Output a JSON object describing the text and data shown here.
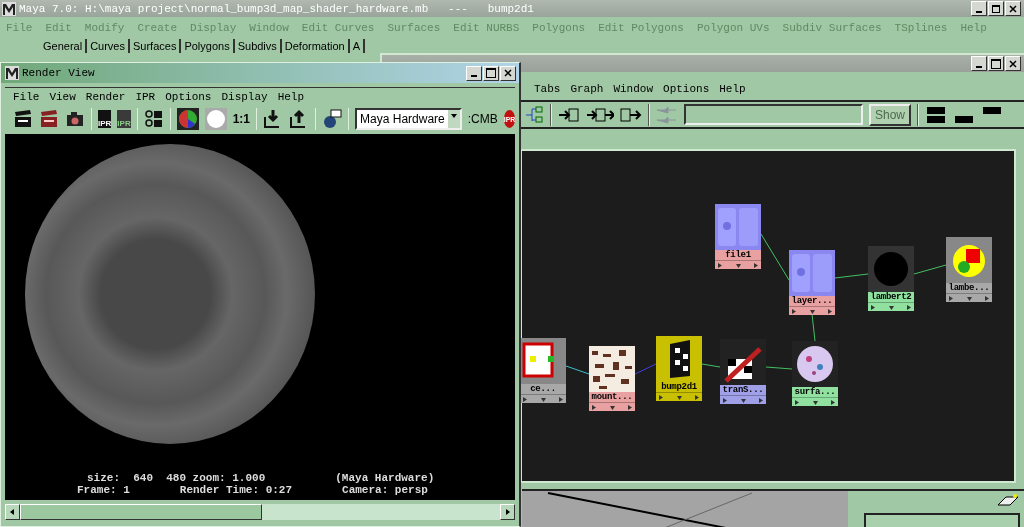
{
  "main_window": {
    "title": "Maya 7.0: H:\\maya project\\normal_bump3d_map_shader_hardware.mb   ---   bump2d1",
    "menu": [
      "File",
      "Edit",
      "Modify",
      "Create",
      "Display",
      "Window",
      "Edit Curves",
      "Surfaces",
      "Edit NURBS",
      "Polygons",
      "Edit Polygons",
      "Polygon UVs",
      "Subdiv Surfaces",
      "TSplines",
      "Help"
    ],
    "shelf_tabs": [
      "General",
      "Curves",
      "Surfaces",
      "Polygons",
      "Subdivs",
      "Deformation",
      "A"
    ]
  },
  "render_view": {
    "title": "Render View",
    "menu": [
      "File",
      "View",
      "Render",
      "IPR",
      "Options",
      "Display",
      "Help"
    ],
    "icon_texts": [
      "IPR",
      "IPR",
      "1:1"
    ],
    "renderer": "Maya Hardware",
    "cmb": ":CMB",
    "ipr_button": "IPR",
    "info_lines": [
      [
        "size:  640  480 zoom: 1.000",
        "(Maya Hardware)"
      ],
      [
        "Frame: 1",
        "Render Time: 0:27",
        "Camera: persp"
      ]
    ]
  },
  "hypershade": {
    "menu": [
      "Tabs",
      "Graph",
      "Window",
      "Options",
      "Help"
    ],
    "show_button": "Show",
    "nodes": [
      {
        "label": "file1",
        "kind": "normal",
        "color": "#e8a0a0"
      },
      {
        "label": "layer...",
        "kind": "normal",
        "color": "#e8a0a0"
      },
      {
        "label": "lambert2",
        "kind": "black",
        "color": "#90e0a0"
      },
      {
        "label": "lambe...",
        "kind": "shader",
        "color": "#a8a8a8"
      },
      {
        "label": "ce...",
        "kind": "place",
        "color": "#a8a8a8"
      },
      {
        "label": "mount...",
        "kind": "noise",
        "color": "#e8a0a0"
      },
      {
        "label": "bump2d1",
        "kind": "bump",
        "color": "#c8c000"
      },
      {
        "label": "tranS...",
        "kind": "trans",
        "color": "#a0a0e8"
      },
      {
        "label": "surfa...",
        "kind": "surface",
        "color": "#90e0a0"
      }
    ]
  }
}
